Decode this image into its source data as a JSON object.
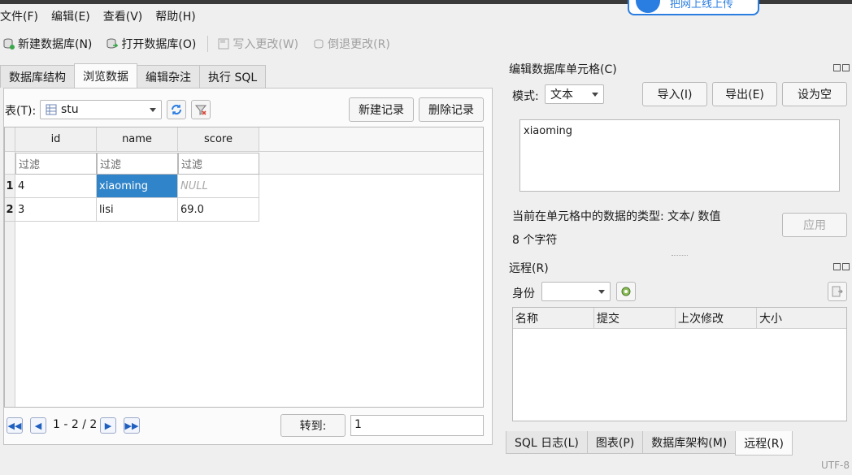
{
  "overlay": {
    "label": "把网上线上传"
  },
  "menu": [
    {
      "label": "文件(F)"
    },
    {
      "label": "编辑(E)"
    },
    {
      "label": "查看(V)"
    },
    {
      "label": "帮助(H)"
    }
  ],
  "toolbar": {
    "new_db": "新建数据库(N)",
    "open_db": "打开数据库(O)",
    "write_changes": "写入更改(W)",
    "revert_changes": "倒退更改(R)"
  },
  "left_tabs": [
    {
      "label": "数据库结构"
    },
    {
      "label": "浏览数据"
    },
    {
      "label": "编辑杂注"
    },
    {
      "label": "执行 SQL"
    }
  ],
  "browse": {
    "table_label": "表(T):",
    "table_value": "stu",
    "new_record": "新建记录",
    "delete_record": "删除记录",
    "columns": [
      "id",
      "name",
      "score"
    ],
    "filter_placeholder": "过滤",
    "rows": [
      {
        "num": "1",
        "cells": [
          "4",
          "xiaoming",
          "NULL"
        ]
      },
      {
        "num": "2",
        "cells": [
          "3",
          "lisi",
          "69.0"
        ]
      }
    ],
    "page_info": "1 - 2 / 2",
    "goto_label": "转到:",
    "goto_value": "1"
  },
  "edit_cell": {
    "title": "编辑数据库单元格(C)",
    "mode_label": "模式:",
    "mode_value": "文本",
    "import": "导入(I)",
    "export": "导出(E)",
    "set_null": "设为空",
    "content": "xiaoming",
    "type_info": "当前在单元格中的数据的类型: 文本/ 数值",
    "char_count": "8 个字符",
    "apply": "应用"
  },
  "remote": {
    "title": "远程(R)",
    "identity_label": "身份",
    "identity_value": "",
    "columns": [
      "名称",
      "提交",
      "上次修改",
      "大小"
    ]
  },
  "bottom_tabs": [
    {
      "label": "SQL 日志(L)"
    },
    {
      "label": "图表(P)"
    },
    {
      "label": "数据库架构(M)"
    },
    {
      "label": "远程(R)"
    }
  ],
  "status": {
    "encoding": "UTF-8"
  },
  "colors": {
    "selection": "#3084c9",
    "accent": "#2a7de1"
  }
}
